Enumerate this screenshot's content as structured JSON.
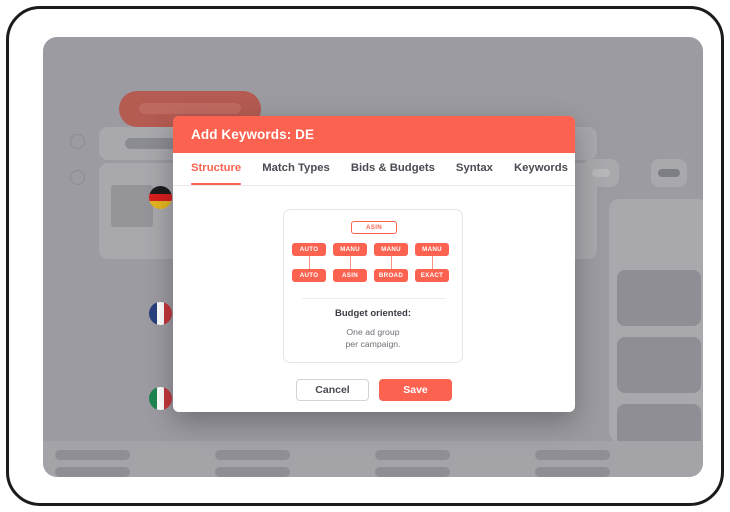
{
  "modal": {
    "title": "Add Keywords: DE",
    "tabs": [
      {
        "label": "Structure",
        "active": true
      },
      {
        "label": "Match Types",
        "active": false
      },
      {
        "label": "Bids & Budgets",
        "active": false
      },
      {
        "label": "Syntax",
        "active": false
      },
      {
        "label": "Keywords",
        "active": false
      }
    ],
    "diagram": {
      "root": {
        "label": "ASIN",
        "style": "outlined"
      },
      "row_upper": [
        "AUTO",
        "MANU",
        "MANU",
        "MANU"
      ],
      "row_lower": [
        "AUTO",
        "ASIN",
        "BROAD",
        "EXACT"
      ],
      "heading": "Budget oriented:",
      "description_line_1": "One ad group",
      "description_line_2": "per campaign."
    },
    "buttons": {
      "cancel": "Cancel",
      "save": "Save"
    },
    "colors": {
      "accent": "#fb6250",
      "header_text": "#ffffff",
      "tab_inactive": "#4a4a52"
    }
  },
  "background": {
    "flags": [
      {
        "name": "germany-flag",
        "bands": [
          "#1c1c1c",
          "#d7201f",
          "#e5b520"
        ],
        "orientation": "horizontal"
      },
      {
        "name": "france-flag",
        "bands": [
          "#28407f",
          "#ffffff",
          "#c2373c"
        ],
        "orientation": "vertical"
      },
      {
        "name": "italy-flag",
        "bands": [
          "#1e8551",
          "#ffffff",
          "#c2373c"
        ],
        "orientation": "vertical"
      }
    ],
    "colors": {
      "page": "#9b9ba1",
      "topbar_pill": "#b45b52",
      "block": "#a8a8ad",
      "card": "#8e8e94"
    },
    "footer_columns": 4,
    "footer_rows": 2
  }
}
